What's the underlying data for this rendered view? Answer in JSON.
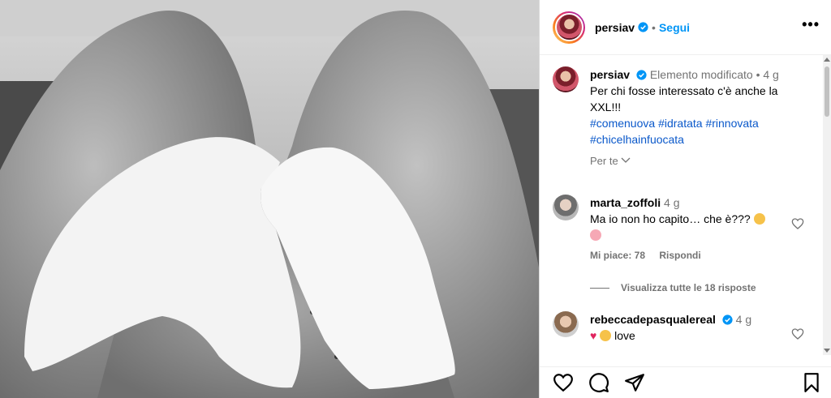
{
  "post": {
    "username": "persiav",
    "follow_label": "Segui",
    "more_label": "•••"
  },
  "caption": {
    "username": "persiav",
    "edited": "Elemento modificato",
    "time": "4 g",
    "text": "Per chi fosse interessato c'è anche la XXL!!!",
    "hashtags": [
      "#comenuova",
      "#idratata",
      "#rinnovata",
      "#chicelhainfuocata"
    ],
    "per_te_label": "Per te"
  },
  "comments": [
    {
      "username": "marta_zoffoli",
      "time": "4 g",
      "text": "Ma io non ho capito… che è???",
      "likes_label": "Mi piace: 78",
      "reply_label": "Rispondi",
      "view_replies_label": "Visualizza tutte le 18 risposte"
    },
    {
      "username": "rebeccadepasqualereal",
      "time": "4 g",
      "text": "love"
    }
  ],
  "icons": {
    "like": "heart-icon",
    "comment": "comment-icon",
    "share": "send-icon",
    "save": "bookmark-icon",
    "verified": "verified-badge-icon"
  },
  "colors": {
    "accent": "#0095f6",
    "hashtag": "#00376b",
    "muted": "#737373"
  }
}
